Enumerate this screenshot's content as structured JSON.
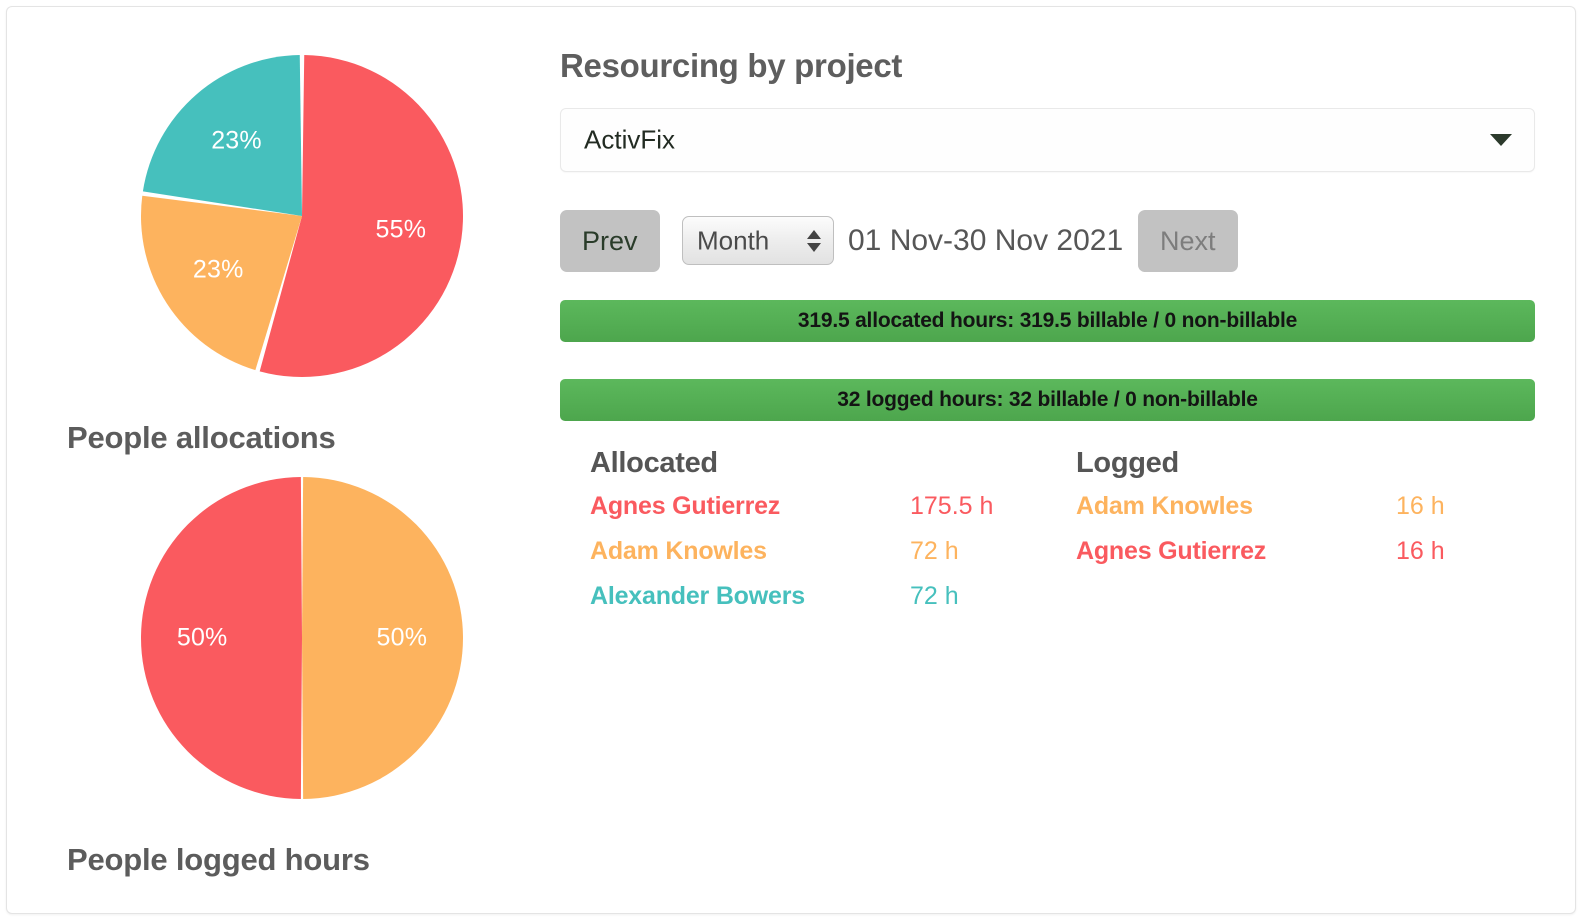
{
  "panel": {
    "title": "Resourcing by project",
    "project_selected": "ActivFix",
    "prev_label": "Prev",
    "next_label": "Next",
    "unit_selected": "Month",
    "period_text": "01 Nov-30 Nov 2021",
    "allocated_summary": "319.5 allocated hours: 319.5 billable / 0 non-billable",
    "logged_summary": "32 logged hours: 32 billable / 0 non-billable"
  },
  "breakdown": {
    "allocated_heading": "Allocated",
    "logged_heading": "Logged",
    "allocated_rows": [
      {
        "name": "Agnes Gutierrez",
        "hours": "175.5 h",
        "color": "#fa5a5f"
      },
      {
        "name": "Adam Knowles",
        "hours": "72 h",
        "color": "#fdb35e"
      },
      {
        "name": "Alexander Bowers",
        "hours": "72 h",
        "color": "#46c0bd"
      }
    ],
    "logged_rows": [
      {
        "name": "Adam Knowles",
        "hours": "16 h",
        "color": "#fdb35e"
      },
      {
        "name": "Agnes Gutierrez",
        "hours": "16 h",
        "color": "#fa5a5f"
      }
    ]
  },
  "colors": {
    "red": "#fa5a5f",
    "orange": "#fdb35e",
    "teal": "#46c0bd",
    "green_bar": "#52ae4f",
    "button_gray": "#c2c2c2",
    "heading_gray": "#5c5c5c"
  },
  "chart_data": [
    {
      "type": "pie",
      "title": "People allocations",
      "categories": [
        "Agnes Gutierrez",
        "Adam Knowles",
        "Alexander Bowers"
      ],
      "values": [
        55,
        23,
        23
      ],
      "labels": [
        "55%",
        "23%",
        "23%"
      ],
      "colors": [
        "#fa5a5f",
        "#fdb35e",
        "#46c0bd"
      ],
      "legend": "none",
      "start_angle": 0,
      "direction": "clockwise"
    },
    {
      "type": "pie",
      "title": "People logged hours",
      "categories": [
        "Adam Knowles",
        "Agnes Gutierrez"
      ],
      "values": [
        50,
        50
      ],
      "labels": [
        "50%",
        "50%"
      ],
      "colors": [
        "#fdb35e",
        "#fa5a5f"
      ],
      "legend": "none",
      "start_angle": 0,
      "direction": "clockwise"
    }
  ]
}
